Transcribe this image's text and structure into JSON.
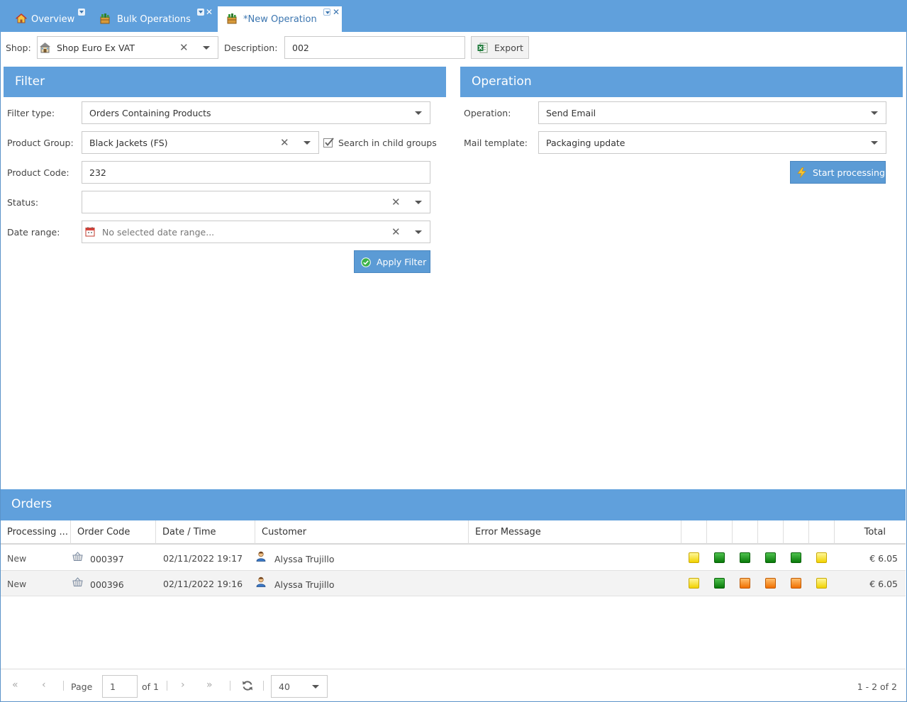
{
  "tabs": [
    {
      "label": "Overview",
      "icon": "home-icon"
    },
    {
      "label": "Bulk Operations",
      "icon": "basket-icon"
    },
    {
      "label": "*New Operation",
      "icon": "basket-icon"
    }
  ],
  "toolbar": {
    "shop_label": "Shop:",
    "shop_value": "Shop Euro Ex VAT",
    "description_label": "Description:",
    "description_value": "002",
    "export_label": "Export"
  },
  "filter": {
    "title": "Filter",
    "filter_type_label": "Filter type:",
    "filter_type_value": "Orders Containing Products",
    "product_group_label": "Product Group:",
    "product_group_value": "Black Jackets (FS)",
    "search_child_label": "Search in child groups",
    "search_child_checked": true,
    "product_code_label": "Product Code:",
    "product_code_value": "232",
    "status_label": "Status:",
    "status_value": "",
    "date_range_label": "Date range:",
    "date_range_placeholder": "No selected date range...",
    "apply_label": "Apply Filter"
  },
  "operation": {
    "title": "Operation",
    "operation_label": "Operation:",
    "operation_value": "Send Email",
    "mail_template_label": "Mail template:",
    "mail_template_value": "Packaging update",
    "start_label": "Start processing"
  },
  "orders": {
    "title": "Orders",
    "columns": [
      "Processing ...",
      "Order Code",
      "Date / Time",
      "Customer",
      "Error Message",
      "Total"
    ],
    "rows": [
      {
        "status": "New",
        "code": "000397",
        "datetime": "02/11/2022 19:17",
        "customer": "Alyssa Trujillo",
        "error": "",
        "lamps": [
          "yellow",
          "green",
          "green",
          "green",
          "green",
          "yellow"
        ],
        "total": "€ 6.05"
      },
      {
        "status": "New",
        "code": "000396",
        "datetime": "02/11/2022 19:16",
        "customer": "Alyssa Trujillo",
        "error": "",
        "lamps": [
          "yellow",
          "green",
          "orange",
          "orange",
          "orange",
          "yellow"
        ],
        "total": "€ 6.05"
      }
    ]
  },
  "pager": {
    "page_label": "Page",
    "page_value": "1",
    "of_label": "of 1",
    "page_size": "40",
    "summary": "1 - 2 of 2"
  },
  "colors": {
    "header_blue": "#60a0dc",
    "button_blue": "#5b9bd5"
  }
}
